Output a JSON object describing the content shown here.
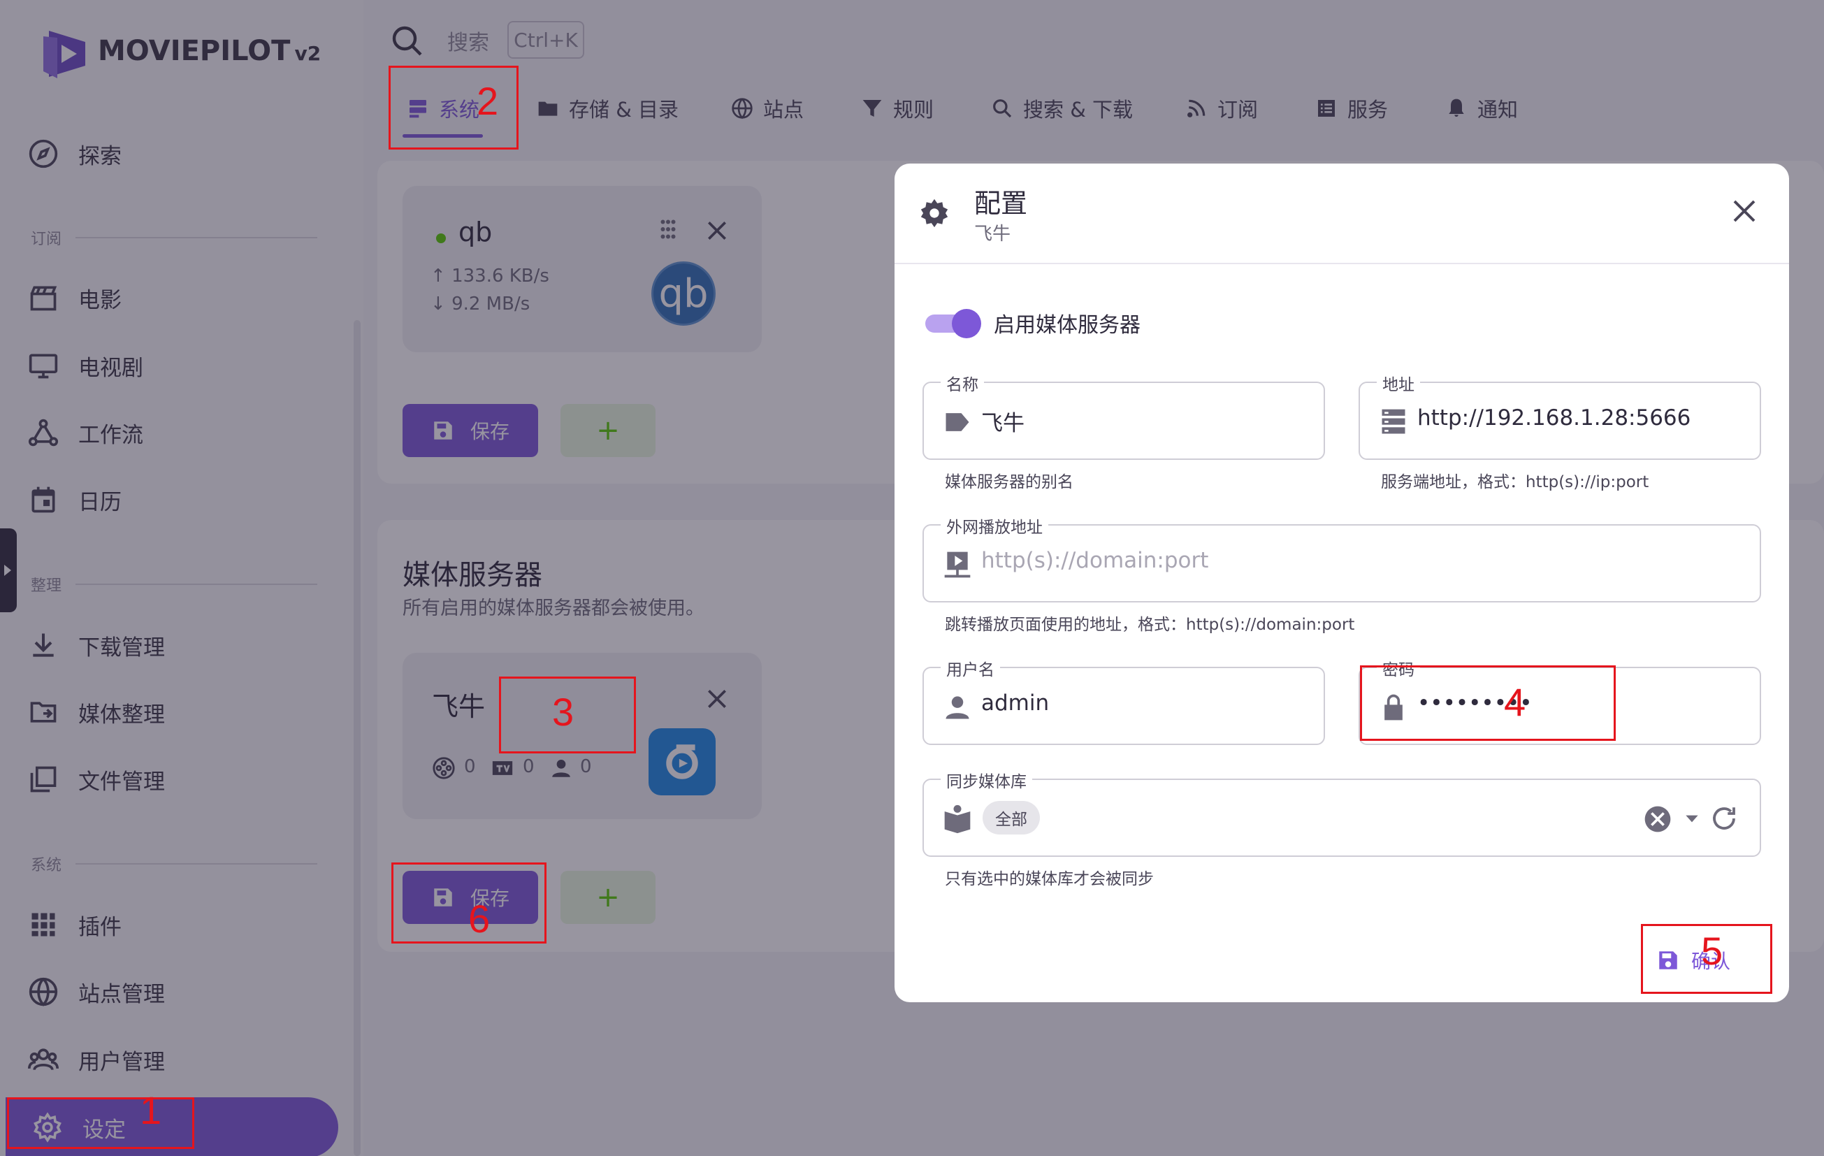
{
  "app": {
    "brand": "MOVIEPILOT",
    "version": "v2"
  },
  "sidebar": {
    "items": {
      "explore": "探索",
      "movie": "电影",
      "tv": "电视剧",
      "workflow": "工作流",
      "calendar": "日历",
      "download": "下载管理",
      "media_organize": "媒体整理",
      "file": "文件管理",
      "plugins": "插件",
      "sites": "站点管理",
      "users": "用户管理",
      "settings": "设定"
    },
    "sections": {
      "subscribe": "订阅",
      "organize": "整理",
      "system": "系统"
    }
  },
  "search": {
    "placeholder": "搜索",
    "shortcut": "Ctrl+K"
  },
  "tabs": {
    "system": "系统",
    "storage": "存储 & 目录",
    "sites": "站点",
    "rules": "规则",
    "search_download": "搜索 & 下载",
    "subscribe": "订阅",
    "services": "服务",
    "notify": "通知"
  },
  "downloader": {
    "name": "qb",
    "upload_speed": "133.6 KB/s",
    "download_speed": "9.2 MB/s",
    "badge": "qb",
    "save_label": "保存",
    "add_label": "+"
  },
  "media_server_section": {
    "title": "媒体服务器",
    "description": "所有启用的媒体服务器都会被使用。",
    "card": {
      "name": "飞牛",
      "movies": "0",
      "tv": "0",
      "users": "0"
    },
    "save_label": "保存",
    "add_label": "+"
  },
  "dialog": {
    "title": "配置",
    "subtitle": "飞牛",
    "enable_label": "启用媒体服务器",
    "enabled": true,
    "name": {
      "label": "名称",
      "value": "飞牛",
      "hint": "媒体服务器的别名"
    },
    "host": {
      "label": "地址",
      "value": "http://192.168.1.28:5666",
      "hint": "服务端地址，格式：http(s)://ip:port"
    },
    "play_host": {
      "label": "外网播放地址",
      "placeholder": "http(s)://domain:port",
      "hint": "跳转播放页面使用的地址，格式：http(s)://domain:port"
    },
    "username": {
      "label": "用户名",
      "value": "admin"
    },
    "password": {
      "label": "密码",
      "value": "•••••••••"
    },
    "sync_libraries": {
      "label": "同步媒体库",
      "chip": "全部",
      "hint": "只有选中的媒体库才会被同步"
    },
    "confirm_label": "确认"
  },
  "annotations": [
    "1",
    "2",
    "3",
    "4",
    "5",
    "6"
  ],
  "colors": {
    "accent": "#7D58D8",
    "annotation": "#E5151D",
    "success": "#56CA00"
  }
}
